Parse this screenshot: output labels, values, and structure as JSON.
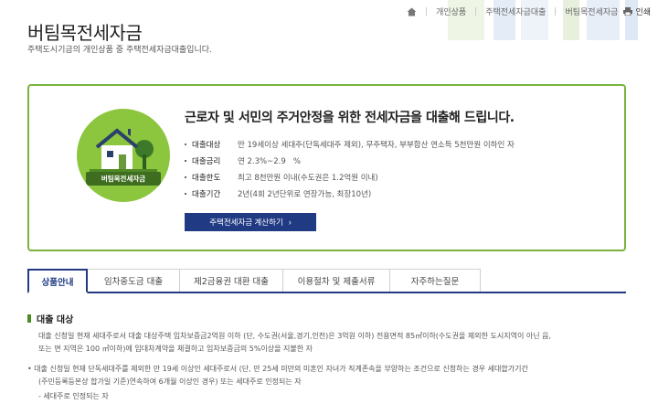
{
  "breadcrumb": {
    "items": [
      "개인상품",
      "주택전세자금대출",
      "버팀목전세자금"
    ],
    "print_label": "인쇄"
  },
  "page": {
    "title": "버팀목전세자금",
    "description": "주택도시기금의 개인상품 중 주택전세자금대출입니다."
  },
  "product": {
    "badge_label": "버팀목전세자금",
    "headline": "근로자 및 서민의 주거안정을 위한 전세자금을 대출해 드립니다.",
    "specs": [
      {
        "label": "대출대상",
        "value": "만 19세이상 세대주(단독세대주 제외), 무주택자, 부부합산 연소득 5천만원 이하인 자"
      },
      {
        "label": "대출금리",
        "value": "연 2.3%~2.9   %"
      },
      {
        "label": "대출한도",
        "value": "최고 8천만원 이내(수도권은 1.2억원 이내)"
      },
      {
        "label": "대출기간",
        "value": "2년(4회 2년단위로 연장가능, 최장10년)"
      }
    ],
    "calc_button": "주택전세자금 계산하기",
    "colors": {
      "accent_green": "#7ab33b",
      "navy": "#213a84"
    }
  },
  "tabs": [
    {
      "label": "상품안내",
      "active": true
    },
    {
      "label": "임차중도금 대출",
      "active": false
    },
    {
      "label": "제2금융권 대환 대출",
      "active": false
    },
    {
      "label": "이용절차 및 제출서류",
      "active": false
    },
    {
      "label": "자주하는질문",
      "active": false
    }
  ],
  "content": {
    "section_title": "대출 대상",
    "para1_line1": "대출 신청일 현재 세대주로서 대출 대상주택 임차보증금2억원 이하 (단, 수도권(서울,경기,인천)은 3억원 이하) 전용면적 85㎡이하(수도권을 제외한 도시지역이 아닌 읍,",
    "para1_line2": "또는 면 지역은 100 ㎡이하)에 임대차계약을 체결하고 임차보증금의 5%이상을 지불한 자",
    "bullet_line1": "• 대출 신청일 현재 단독세대주를 제외한 만 19세 이상인 세대주로서 (단, 만 25세 미만의 미혼인 자녀가 직계존속을 부양하는 조건으로 신청하는 경우 세대합가기간",
    "bullet_line2": "(주민등록등본상 합가일 기준)연속하여 6개월 이상인 경우) 또는 세대주로 인정되는 자",
    "bullet_line3": "- 세대주로 인정되는 자"
  }
}
